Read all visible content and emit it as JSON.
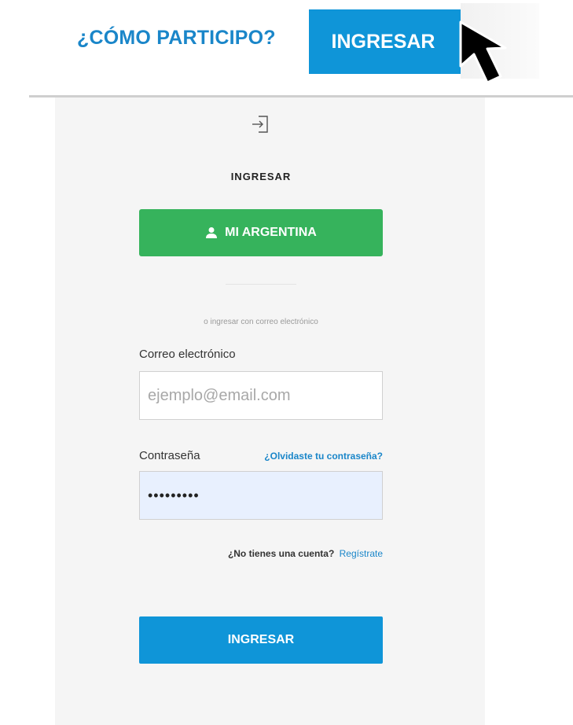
{
  "nav": {
    "how_to_participate": "¿CÓMO PARTICIPO?",
    "login_button": "INGRESAR"
  },
  "login": {
    "icon": "login-arrow-icon",
    "title": "INGRESAR",
    "mi_argentina_button": "MI ARGENTINA",
    "mi_argentina_icon": "user-icon",
    "divider_text": "o ingresar con correo electrónico",
    "email_label": "Correo electrónico",
    "email_placeholder": "ejemplo@email.com",
    "email_value": "",
    "password_label": "Contraseña",
    "forgot_password": "¿Olvidaste tu contraseña?",
    "password_value": "•••••••••",
    "no_account": "¿No tienes una cuenta?",
    "register_link": "Regístrate",
    "submit_button": "INGRESAR"
  },
  "colors": {
    "accent_blue": "#0f95d8",
    "link_blue": "#1a86c9",
    "green": "#36b35c",
    "panel_background": "#f5f5f5",
    "autofill_background": "#e8f0fe"
  }
}
